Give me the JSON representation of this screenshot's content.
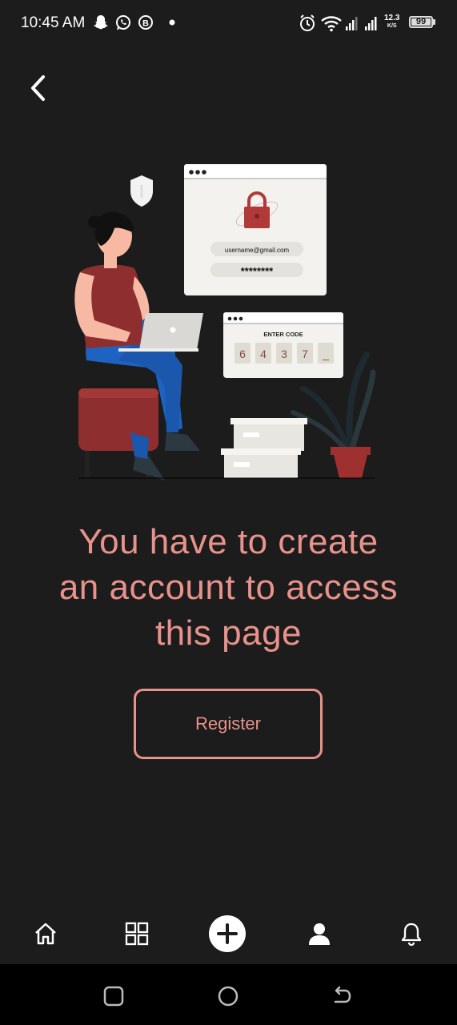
{
  "status_bar": {
    "time": "10:45 AM",
    "net_speed_value": "12.3",
    "net_speed_unit": "K/S",
    "battery": "99",
    "left_icons": [
      "snapchat-icon",
      "whatsapp-icon",
      "b-icon",
      "dot-icon"
    ],
    "right_icons": [
      "alarm-icon",
      "wifi-icon",
      "signal-icon",
      "signal-icon"
    ]
  },
  "illustration": {
    "email": "username@gmail.com",
    "password_mask": "********",
    "code_title": "ENTER CODE",
    "code_digits": [
      "6",
      "4",
      "3",
      "7",
      "_"
    ]
  },
  "main": {
    "message_line1": "You have to create",
    "message_line2": "an account to access",
    "message_line3": "this page",
    "register_label": "Register"
  },
  "bottom_nav": {
    "items": [
      "home-icon",
      "grid-icon",
      "add-icon",
      "profile-icon",
      "bell-icon"
    ]
  },
  "system_nav": [
    "recents-icon",
    "home-circle-icon",
    "back-arrow-icon"
  ],
  "colors": {
    "background": "#1c1c1c",
    "accent": "#e8928b",
    "lock_red": "#b03a3a"
  }
}
